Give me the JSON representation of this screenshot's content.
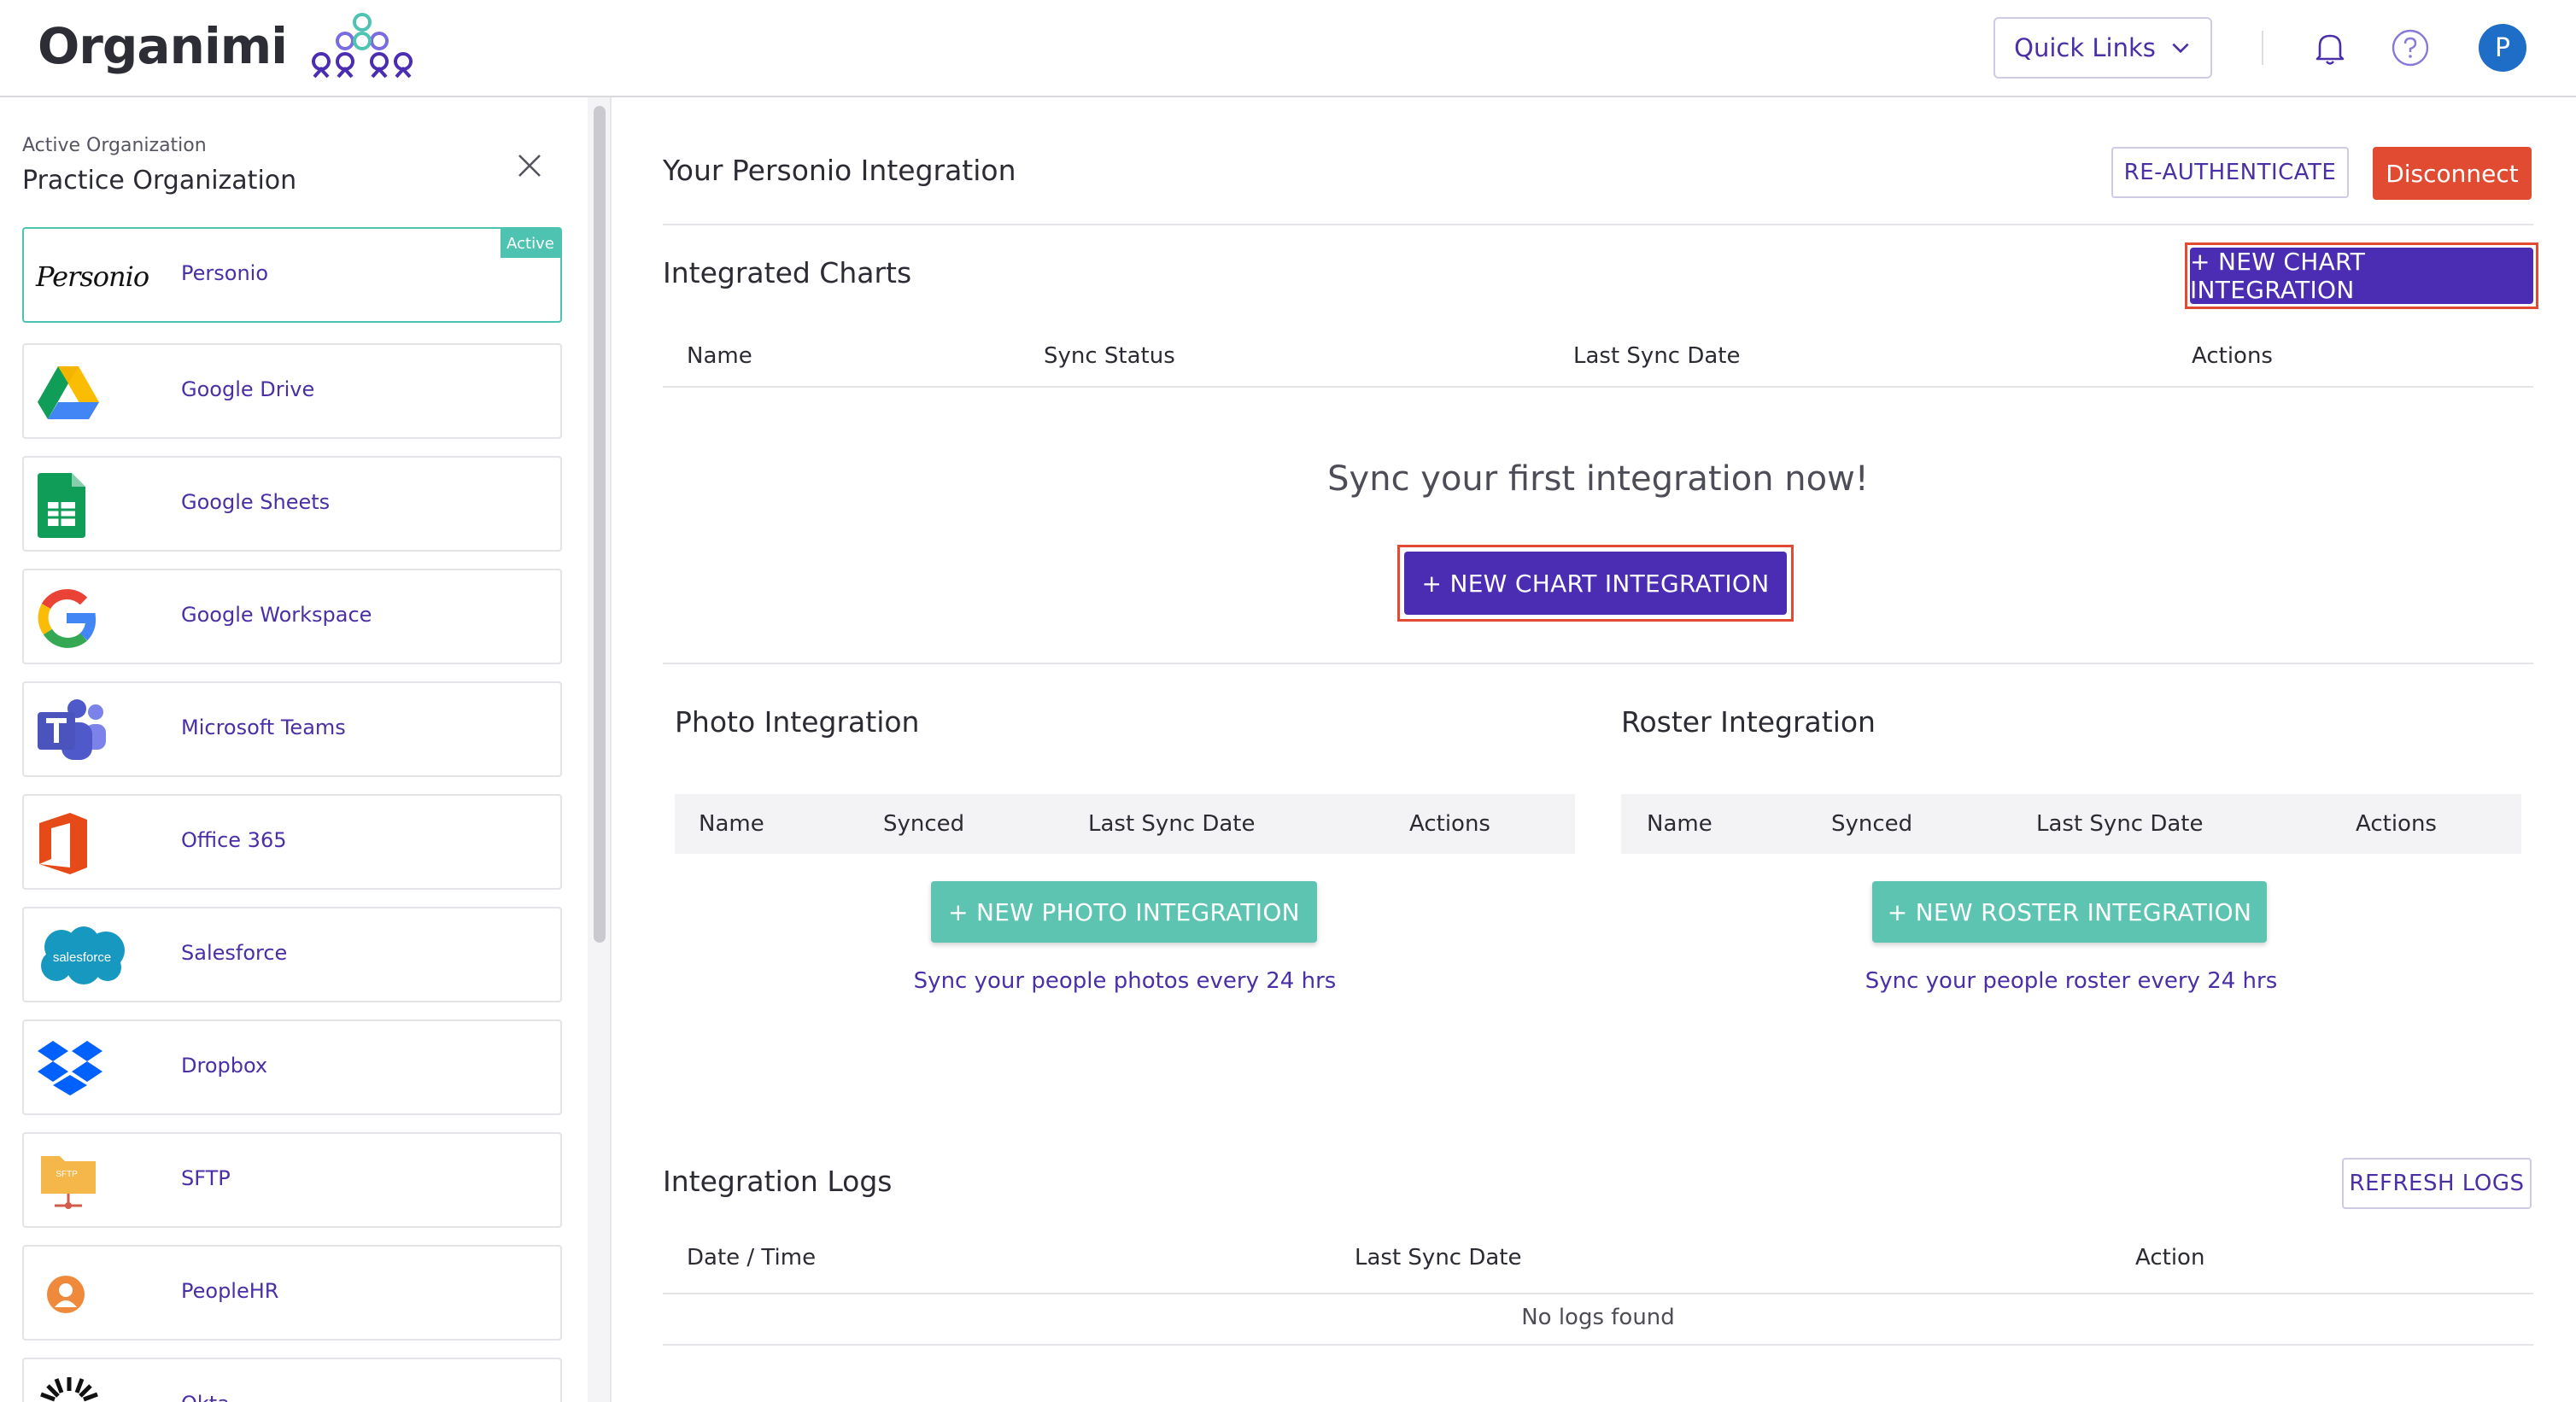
{
  "app": {
    "logo_text": "Organimi",
    "quick_links_label": "Quick Links",
    "avatar_initial": "P"
  },
  "sidebar": {
    "active_org_label": "Active Organization",
    "active_org_name": "Practice Organization",
    "active_badge": "Active",
    "items": [
      {
        "label": "Personio",
        "icon": "personio-logo-icon",
        "active": true
      },
      {
        "label": "Google Drive",
        "icon": "google-drive-icon"
      },
      {
        "label": "Google Sheets",
        "icon": "google-sheets-icon"
      },
      {
        "label": "Google Workspace",
        "icon": "google-g-icon"
      },
      {
        "label": "Microsoft Teams",
        "icon": "microsoft-teams-icon"
      },
      {
        "label": "Office 365",
        "icon": "office-365-icon"
      },
      {
        "label": "Salesforce",
        "icon": "salesforce-cloud-icon"
      },
      {
        "label": "Dropbox",
        "icon": "dropbox-icon"
      },
      {
        "label": "SFTP",
        "icon": "sftp-folder-icon"
      },
      {
        "label": "PeopleHR",
        "icon": "peoplehr-icon"
      },
      {
        "label": "Okta",
        "icon": "okta-icon"
      }
    ],
    "logo_texts": {
      "personio": "Personio",
      "salesforce": "salesforce",
      "sftp": "SFTP"
    }
  },
  "main": {
    "integration_title": "Your Personio Integration",
    "reauth_label": "RE-AUTHENTICATE",
    "disconnect_label": "Disconnect",
    "charts": {
      "title": "Integrated Charts",
      "new_chart_label": "+ NEW CHART INTEGRATION",
      "columns": [
        "Name",
        "Sync Status",
        "Last Sync Date",
        "Actions"
      ],
      "empty_message": "Sync your first integration now!",
      "empty_button_label": "+ NEW CHART INTEGRATION"
    },
    "photo": {
      "title": "Photo Integration",
      "columns": [
        "Name",
        "Synced",
        "Last Sync Date",
        "Actions"
      ],
      "button_label": "+ NEW PHOTO INTEGRATION",
      "note": "Sync your people photos every 24 hrs"
    },
    "roster": {
      "title": "Roster Integration",
      "columns": [
        "Name",
        "Synced",
        "Last Sync Date",
        "Actions"
      ],
      "button_label": "+ NEW ROSTER INTEGRATION",
      "note": "Sync your people roster every 24 hrs"
    },
    "logs": {
      "title": "Integration Logs",
      "refresh_label": "REFRESH LOGS",
      "columns": [
        "Date / Time",
        "Last Sync Date",
        "Action"
      ],
      "empty_message": "No logs found"
    }
  },
  "colors": {
    "primary": "#4b2db3",
    "danger": "#e04b32",
    "teal": "#5dc4b2",
    "link": "#4a2fa6"
  }
}
